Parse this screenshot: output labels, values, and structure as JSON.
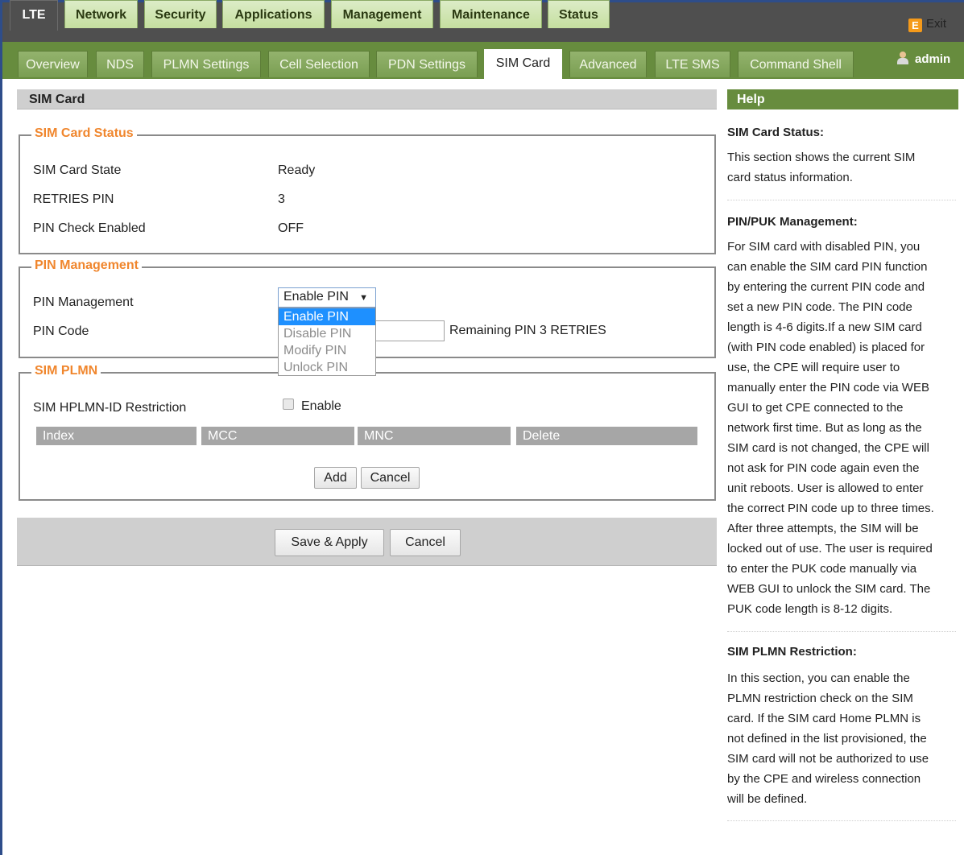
{
  "nav": {
    "main_tabs": [
      "LTE",
      "Network",
      "Security",
      "Applications",
      "Management",
      "Maintenance",
      "Status"
    ],
    "sub_tabs": [
      "Overview",
      "NDS",
      "PLMN Settings",
      "Cell Selection",
      "PDN Settings",
      "SIM Card",
      "Advanced",
      "LTE SMS",
      "Command Shell"
    ],
    "active_main_tab": "LTE",
    "active_sub_tab": "SIM Card",
    "exit_label": "Exit",
    "user": "admin"
  },
  "page": {
    "title": "SIM Card"
  },
  "sim_status": {
    "legend": "SIM Card Status",
    "rows": [
      {
        "label": "SIM Card State",
        "value": "Ready"
      },
      {
        "label": "RETRIES PIN",
        "value": "3"
      },
      {
        "label": "PIN Check Enabled",
        "value": "OFF"
      }
    ]
  },
  "pin_management": {
    "legend": "PIN Management",
    "mgmt_label": "PIN Management",
    "selected": "Enable PIN",
    "options": [
      "Enable PIN",
      "Disable PIN",
      "Modify PIN",
      "Unlock PIN"
    ],
    "pin_code_label": "PIN Code",
    "pin_code_value": "",
    "remaining_text": "Remaining PIN 3 RETRIES"
  },
  "sim_plmn": {
    "legend": "SIM PLMN",
    "restriction_label": "SIM HPLMN-ID Restriction",
    "enable_label": "Enable",
    "enable_checked": false,
    "columns": [
      "Index",
      "MCC",
      "MNC",
      "Delete"
    ],
    "add_label": "Add",
    "cancel_label": "Cancel"
  },
  "actions": {
    "save_label": "Save & Apply",
    "cancel_label": "Cancel"
  },
  "help": {
    "title": "Help",
    "sections": [
      {
        "title": "SIM Card Status:",
        "lines": [
          "This section shows the current SIM",
          "card status information."
        ]
      },
      {
        "title": "PIN/PUK Management:",
        "lines": [
          "For SIM card with disabled PIN, you",
          "can enable the SIM card PIN function",
          "by entering the current PIN code and",
          "set a new PIN code. The PIN code",
          "length is 4-6 digits.If a new SIM card",
          "(with PIN code enabled) is placed for",
          "use, the CPE will require user to",
          "manually enter the PIN code via WEB",
          "GUI to get CPE connected to the",
          "network first time. But as long as the",
          "SIM card is not changed, the CPE will",
          "not ask for PIN code again even the",
          "unit reboots. User is allowed to enter",
          "the correct PIN code up to three times.",
          "After three attempts, the SIM will be",
          "locked out of use. The user is required",
          "to enter the PUK code manually via",
          "WEB GUI to unlock the SIM card. The",
          "PUK code length is 8-12 digits."
        ]
      },
      {
        "title": "SIM PLMN Restriction:",
        "lines": [
          "In this section, you can enable the",
          "PLMN restriction check on the SIM",
          "card. If the SIM card Home PLMN is",
          "not defined in the list provisioned, the",
          "SIM card will not be authorized to use",
          "by the CPE and wireless connection",
          "will be defined."
        ]
      }
    ]
  },
  "colors": {
    "header_dark": "#4f4f4f",
    "nav_green": "#678c3e",
    "tab_light_green": "#c5df9f",
    "legend_orange": "#f0862d",
    "dropdown_highlight": "#1e90ff"
  }
}
